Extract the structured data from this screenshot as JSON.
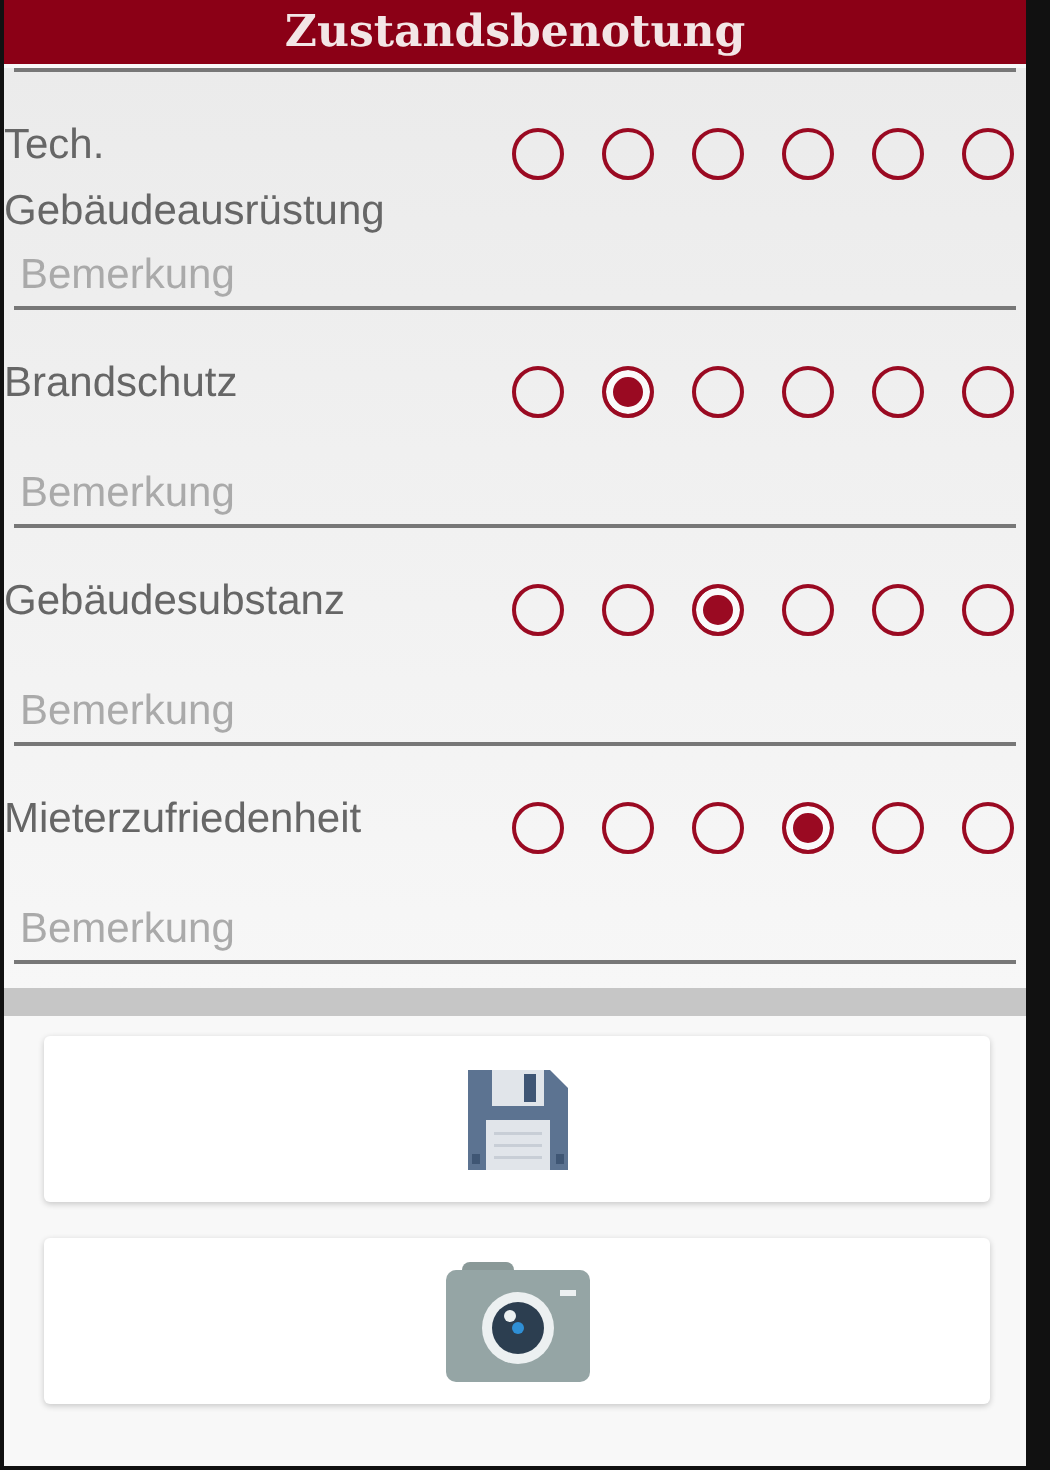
{
  "header": {
    "title": "Zustandsbenotung"
  },
  "criteria": [
    {
      "label": "Tech. Gebäudeausrüstung",
      "options": [
        {
          "selected": false
        },
        {
          "selected": false
        },
        {
          "selected": false
        },
        {
          "selected": false
        },
        {
          "selected": false
        },
        {
          "selected": false
        }
      ],
      "remark": {
        "placeholder": "Bemerkung"
      }
    },
    {
      "label": "Brandschutz",
      "options": [
        {
          "selected": false
        },
        {
          "selected": true
        },
        {
          "selected": false
        },
        {
          "selected": false
        },
        {
          "selected": false
        },
        {
          "selected": false
        }
      ],
      "remark": {
        "placeholder": "Bemerkung"
      }
    },
    {
      "label": "Gebäudesubstanz",
      "options": [
        {
          "selected": false
        },
        {
          "selected": false
        },
        {
          "selected": true
        },
        {
          "selected": false
        },
        {
          "selected": false
        },
        {
          "selected": false
        }
      ],
      "remark": {
        "placeholder": "Bemerkung"
      }
    },
    {
      "label": "Mieterzufriedenheit",
      "options": [
        {
          "selected": false
        },
        {
          "selected": false
        },
        {
          "selected": false
        },
        {
          "selected": true
        },
        {
          "selected": false
        },
        {
          "selected": false
        }
      ],
      "remark": {
        "placeholder": "Bemerkung"
      }
    }
  ],
  "actions": [
    {
      "kind": "save"
    },
    {
      "kind": "camera"
    }
  ]
}
